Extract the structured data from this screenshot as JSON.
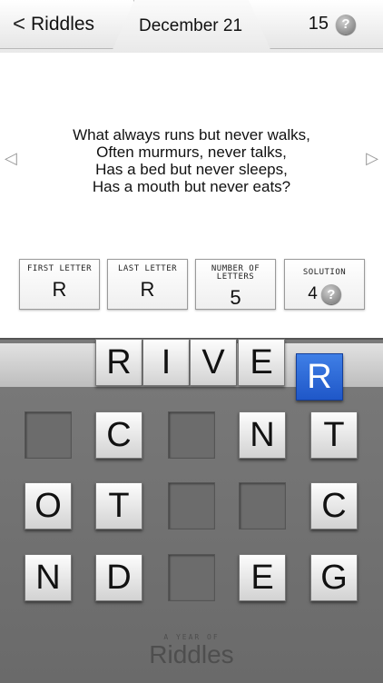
{
  "header": {
    "back_label": "Riddles",
    "back_icon": "chevron-left-icon",
    "date": "December 21",
    "score": "15",
    "help_icon_glyph": "?"
  },
  "riddle": {
    "lines": [
      "What always runs but never walks,",
      "Often murmurs, never talks,",
      "Has a bed but never sleeps,",
      "Has a mouth but never eats?"
    ],
    "prev_icon": "triangle-left-icon",
    "next_icon": "triangle-right-icon"
  },
  "hints": [
    {
      "label": "FIRST LETTER",
      "value": "R"
    },
    {
      "label": "LAST LETTER",
      "value": "R"
    },
    {
      "label": "NUMBER OF LETTERS",
      "value": "5"
    },
    {
      "label": "SOLUTION",
      "value": "4"
    }
  ],
  "answer": [
    "R",
    "I",
    "V",
    "E"
  ],
  "selected_letter": "R",
  "grid": [
    [
      "",
      "C",
      "",
      "N",
      "T"
    ],
    [
      "O",
      "T",
      "",
      "",
      "C"
    ],
    [
      "N",
      "D",
      "",
      "E",
      "G"
    ]
  ],
  "footer": {
    "small": "A YEAR OF",
    "big": "Riddles"
  },
  "colors": {
    "selected_tile": "#2d6ad8",
    "board": "#727272"
  }
}
